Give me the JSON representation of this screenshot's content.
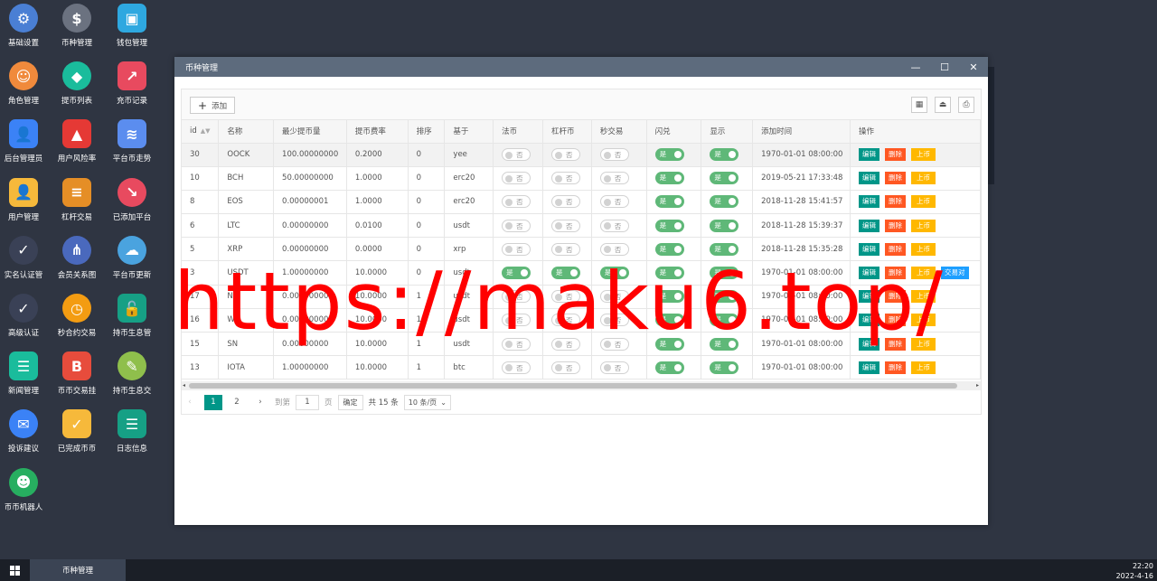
{
  "desktop_icons": [
    {
      "label": "基础设置",
      "glyph": "⚙",
      "color": "#4a7fd4",
      "shape": "round",
      "icon": "gear-icon"
    },
    {
      "label": "币种管理",
      "glyph": "$",
      "color": "#6b7280",
      "shape": "round",
      "icon": "dollar-icon"
    },
    {
      "label": "钱包管理",
      "glyph": "▣",
      "color": "#2ea8e0",
      "shape": "square",
      "icon": "wallet-icon"
    },
    {
      "label": "角色管理",
      "glyph": "☺",
      "color": "#f08a3c",
      "shape": "round",
      "icon": "role-icon"
    },
    {
      "label": "提币列表",
      "glyph": "◆",
      "color": "#1abc9c",
      "shape": "round",
      "icon": "withdraw-list-icon"
    },
    {
      "label": "充币记录",
      "glyph": "↗",
      "color": "#e84a5f",
      "shape": "square",
      "icon": "deposit-record-icon"
    },
    {
      "label": "后台管理员",
      "glyph": "👤",
      "color": "#3b82f6",
      "shape": "square",
      "icon": "admin-user-icon"
    },
    {
      "label": "用户风险率",
      "glyph": "▲",
      "color": "#e53935",
      "shape": "square",
      "icon": "alarm-icon"
    },
    {
      "label": "平台币走势",
      "glyph": "≋",
      "color": "#5b8def",
      "shape": "square",
      "icon": "layers-icon"
    },
    {
      "label": "用户管理",
      "glyph": "👤",
      "color": "#f6b93b",
      "shape": "square",
      "icon": "user-search-icon"
    },
    {
      "label": "杠杆交易",
      "glyph": "≡",
      "color": "#e58e26",
      "shape": "square",
      "icon": "stack-icon"
    },
    {
      "label": "已添加平台",
      "glyph": "↘",
      "color": "#e84a5f",
      "shape": "round",
      "icon": "trend-icon"
    },
    {
      "label": "实名认证管",
      "glyph": "✓",
      "color": "#3a4156",
      "shape": "round",
      "icon": "verify-icon"
    },
    {
      "label": "会员关系图",
      "glyph": "⋔",
      "color": "#4a69bd",
      "shape": "round",
      "icon": "relation-icon"
    },
    {
      "label": "平台币更新",
      "glyph": "☁",
      "color": "#4aa3df",
      "shape": "round",
      "icon": "cloud-refresh-icon"
    },
    {
      "label": "高级认证",
      "glyph": "✓",
      "color": "#3a4156",
      "shape": "round",
      "icon": "advanced-verify-icon"
    },
    {
      "label": "秒合约交易",
      "glyph": "◷",
      "color": "#f39c12",
      "shape": "round",
      "icon": "timer-icon"
    },
    {
      "label": "持币生息管",
      "glyph": "🔓",
      "color": "#16a085",
      "shape": "square",
      "icon": "unlock-icon"
    },
    {
      "label": "新闻管理",
      "glyph": "☰",
      "color": "#1abc9c",
      "shape": "square",
      "icon": "news-icon"
    },
    {
      "label": "币币交易挂",
      "glyph": "B",
      "color": "#e74c3c",
      "shape": "square",
      "icon": "bitcoin-icon"
    },
    {
      "label": "持币生息交",
      "glyph": "✎",
      "color": "#8fbf4c",
      "shape": "round",
      "icon": "hammer-icon"
    },
    {
      "label": "投诉建议",
      "glyph": "✉",
      "color": "#3b82f6",
      "shape": "round",
      "icon": "mail-icon"
    },
    {
      "label": "已完成币币",
      "glyph": "✓",
      "color": "#f6b93b",
      "shape": "square",
      "icon": "check-box-icon"
    },
    {
      "label": "日志信息",
      "glyph": "☰",
      "color": "#16a085",
      "shape": "square",
      "icon": "log-icon"
    },
    {
      "label": "币币机器人",
      "glyph": "☻",
      "color": "#27ae60",
      "shape": "round",
      "icon": "robot-icon"
    }
  ],
  "window": {
    "title": "币种管理",
    "btn_minimize": "—",
    "btn_maximize": "☐",
    "btn_close": "✕"
  },
  "toolbar": {
    "add_label": "添加",
    "add_icon": "+",
    "filter_icon": "▦",
    "export_icon": "⏏",
    "print_icon": "⎙"
  },
  "table": {
    "headers": [
      "id",
      "名称",
      "最少提币量",
      "提币费率",
      "排序",
      "基于",
      "法币",
      "杠杆币",
      "秒交易",
      "闪兑",
      "显示",
      "添加时间",
      "操作"
    ],
    "sort_icon": "▲▼",
    "on_label": "是",
    "off_label": "否",
    "edit_label": "编辑",
    "delete_label": "删除",
    "list_label": "上币",
    "pair_label": "交易对",
    "rows": [
      {
        "id": "30",
        "name": "OOCK",
        "min": "100.00000000",
        "rate": "0.2000",
        "sort": "0",
        "base": "yee",
        "fiat": false,
        "lever": false,
        "sec": false,
        "flash": true,
        "show": true,
        "time": "1970-01-01 08:00:00",
        "pair": false
      },
      {
        "id": "10",
        "name": "BCH",
        "min": "50.00000000",
        "rate": "1.0000",
        "sort": "0",
        "base": "erc20",
        "fiat": false,
        "lever": false,
        "sec": false,
        "flash": true,
        "show": true,
        "time": "2019-05-21 17:33:48",
        "pair": false
      },
      {
        "id": "8",
        "name": "EOS",
        "min": "0.00000001",
        "rate": "1.0000",
        "sort": "0",
        "base": "erc20",
        "fiat": false,
        "lever": false,
        "sec": false,
        "flash": true,
        "show": true,
        "time": "2018-11-28 15:41:57",
        "pair": false
      },
      {
        "id": "6",
        "name": "LTC",
        "min": "0.00000000",
        "rate": "0.0100",
        "sort": "0",
        "base": "usdt",
        "fiat": false,
        "lever": false,
        "sec": false,
        "flash": true,
        "show": true,
        "time": "2018-11-28 15:39:37",
        "pair": false
      },
      {
        "id": "5",
        "name": "XRP",
        "min": "0.00000000",
        "rate": "0.0000",
        "sort": "0",
        "base": "xrp",
        "fiat": false,
        "lever": false,
        "sec": false,
        "flash": true,
        "show": true,
        "time": "2018-11-28 15:35:28",
        "pair": false
      },
      {
        "id": "3",
        "name": "USDT",
        "min": "1.00000000",
        "rate": "10.0000",
        "sort": "0",
        "base": "usdt",
        "fiat": true,
        "lever": true,
        "sec": true,
        "flash": true,
        "show": true,
        "time": "1970-01-01 08:00:00",
        "pair": true
      },
      {
        "id": "17",
        "name": "NE",
        "min": "0.00000000",
        "rate": "10.0000",
        "sort": "1",
        "base": "usdt",
        "fiat": false,
        "lever": false,
        "sec": false,
        "flash": true,
        "show": true,
        "time": "1970-01-01 08:00:00",
        "pair": false
      },
      {
        "id": "16",
        "name": "W",
        "min": "0.00000000",
        "rate": "10.0000",
        "sort": "1",
        "base": "usdt",
        "fiat": false,
        "lever": false,
        "sec": false,
        "flash": true,
        "show": true,
        "time": "1970-01-01 08:00:00",
        "pair": false
      },
      {
        "id": "15",
        "name": "SN",
        "min": "0.00000000",
        "rate": "10.0000",
        "sort": "1",
        "base": "usdt",
        "fiat": false,
        "lever": false,
        "sec": false,
        "flash": true,
        "show": true,
        "time": "1970-01-01 08:00:00",
        "pair": false
      },
      {
        "id": "13",
        "name": "IOTA",
        "min": "1.00000000",
        "rate": "10.0000",
        "sort": "1",
        "base": "btc",
        "fiat": false,
        "lever": false,
        "sec": false,
        "flash": true,
        "show": true,
        "time": "1970-01-01 08:00:00",
        "pair": false
      }
    ]
  },
  "pagination": {
    "prev": "‹",
    "next": "›",
    "pages": [
      "1",
      "2"
    ],
    "goto_label": "到第",
    "goto_value": "1",
    "page_unit": "页",
    "confirm": "确定",
    "total": "共 15 条",
    "page_size": "10 条/页",
    "dropdown_icon": "⌄"
  },
  "watermark": "https://maku6.top/",
  "taskbar": {
    "task_label": "币种管理",
    "time": "22:20",
    "date": "2022-4-16"
  }
}
